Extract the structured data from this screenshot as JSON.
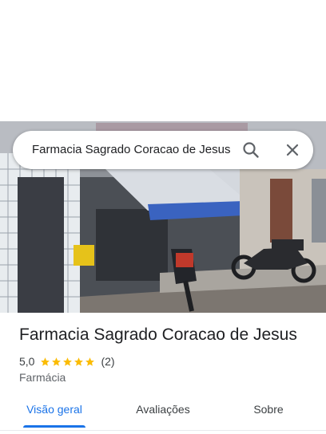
{
  "search": {
    "query": "Farmacia Sagrado Coracao de Jesus"
  },
  "place": {
    "name": "Farmacia Sagrado Coracao de Jesus",
    "rating": "5,0",
    "stars": 5,
    "review_count": "(2)",
    "category": "Farmácia",
    "photo": "storefront-photo"
  },
  "tabs": [
    {
      "label": "Visão geral",
      "active": true
    },
    {
      "label": "Avaliações",
      "active": false
    },
    {
      "label": "Sobre",
      "active": false
    }
  ],
  "colors": {
    "accent": "#1a73e8",
    "star": "#fbbc04",
    "text": "#202124",
    "awning": "#3a63c0"
  },
  "icons": [
    "search-icon",
    "close-icon",
    "star-icon"
  ]
}
